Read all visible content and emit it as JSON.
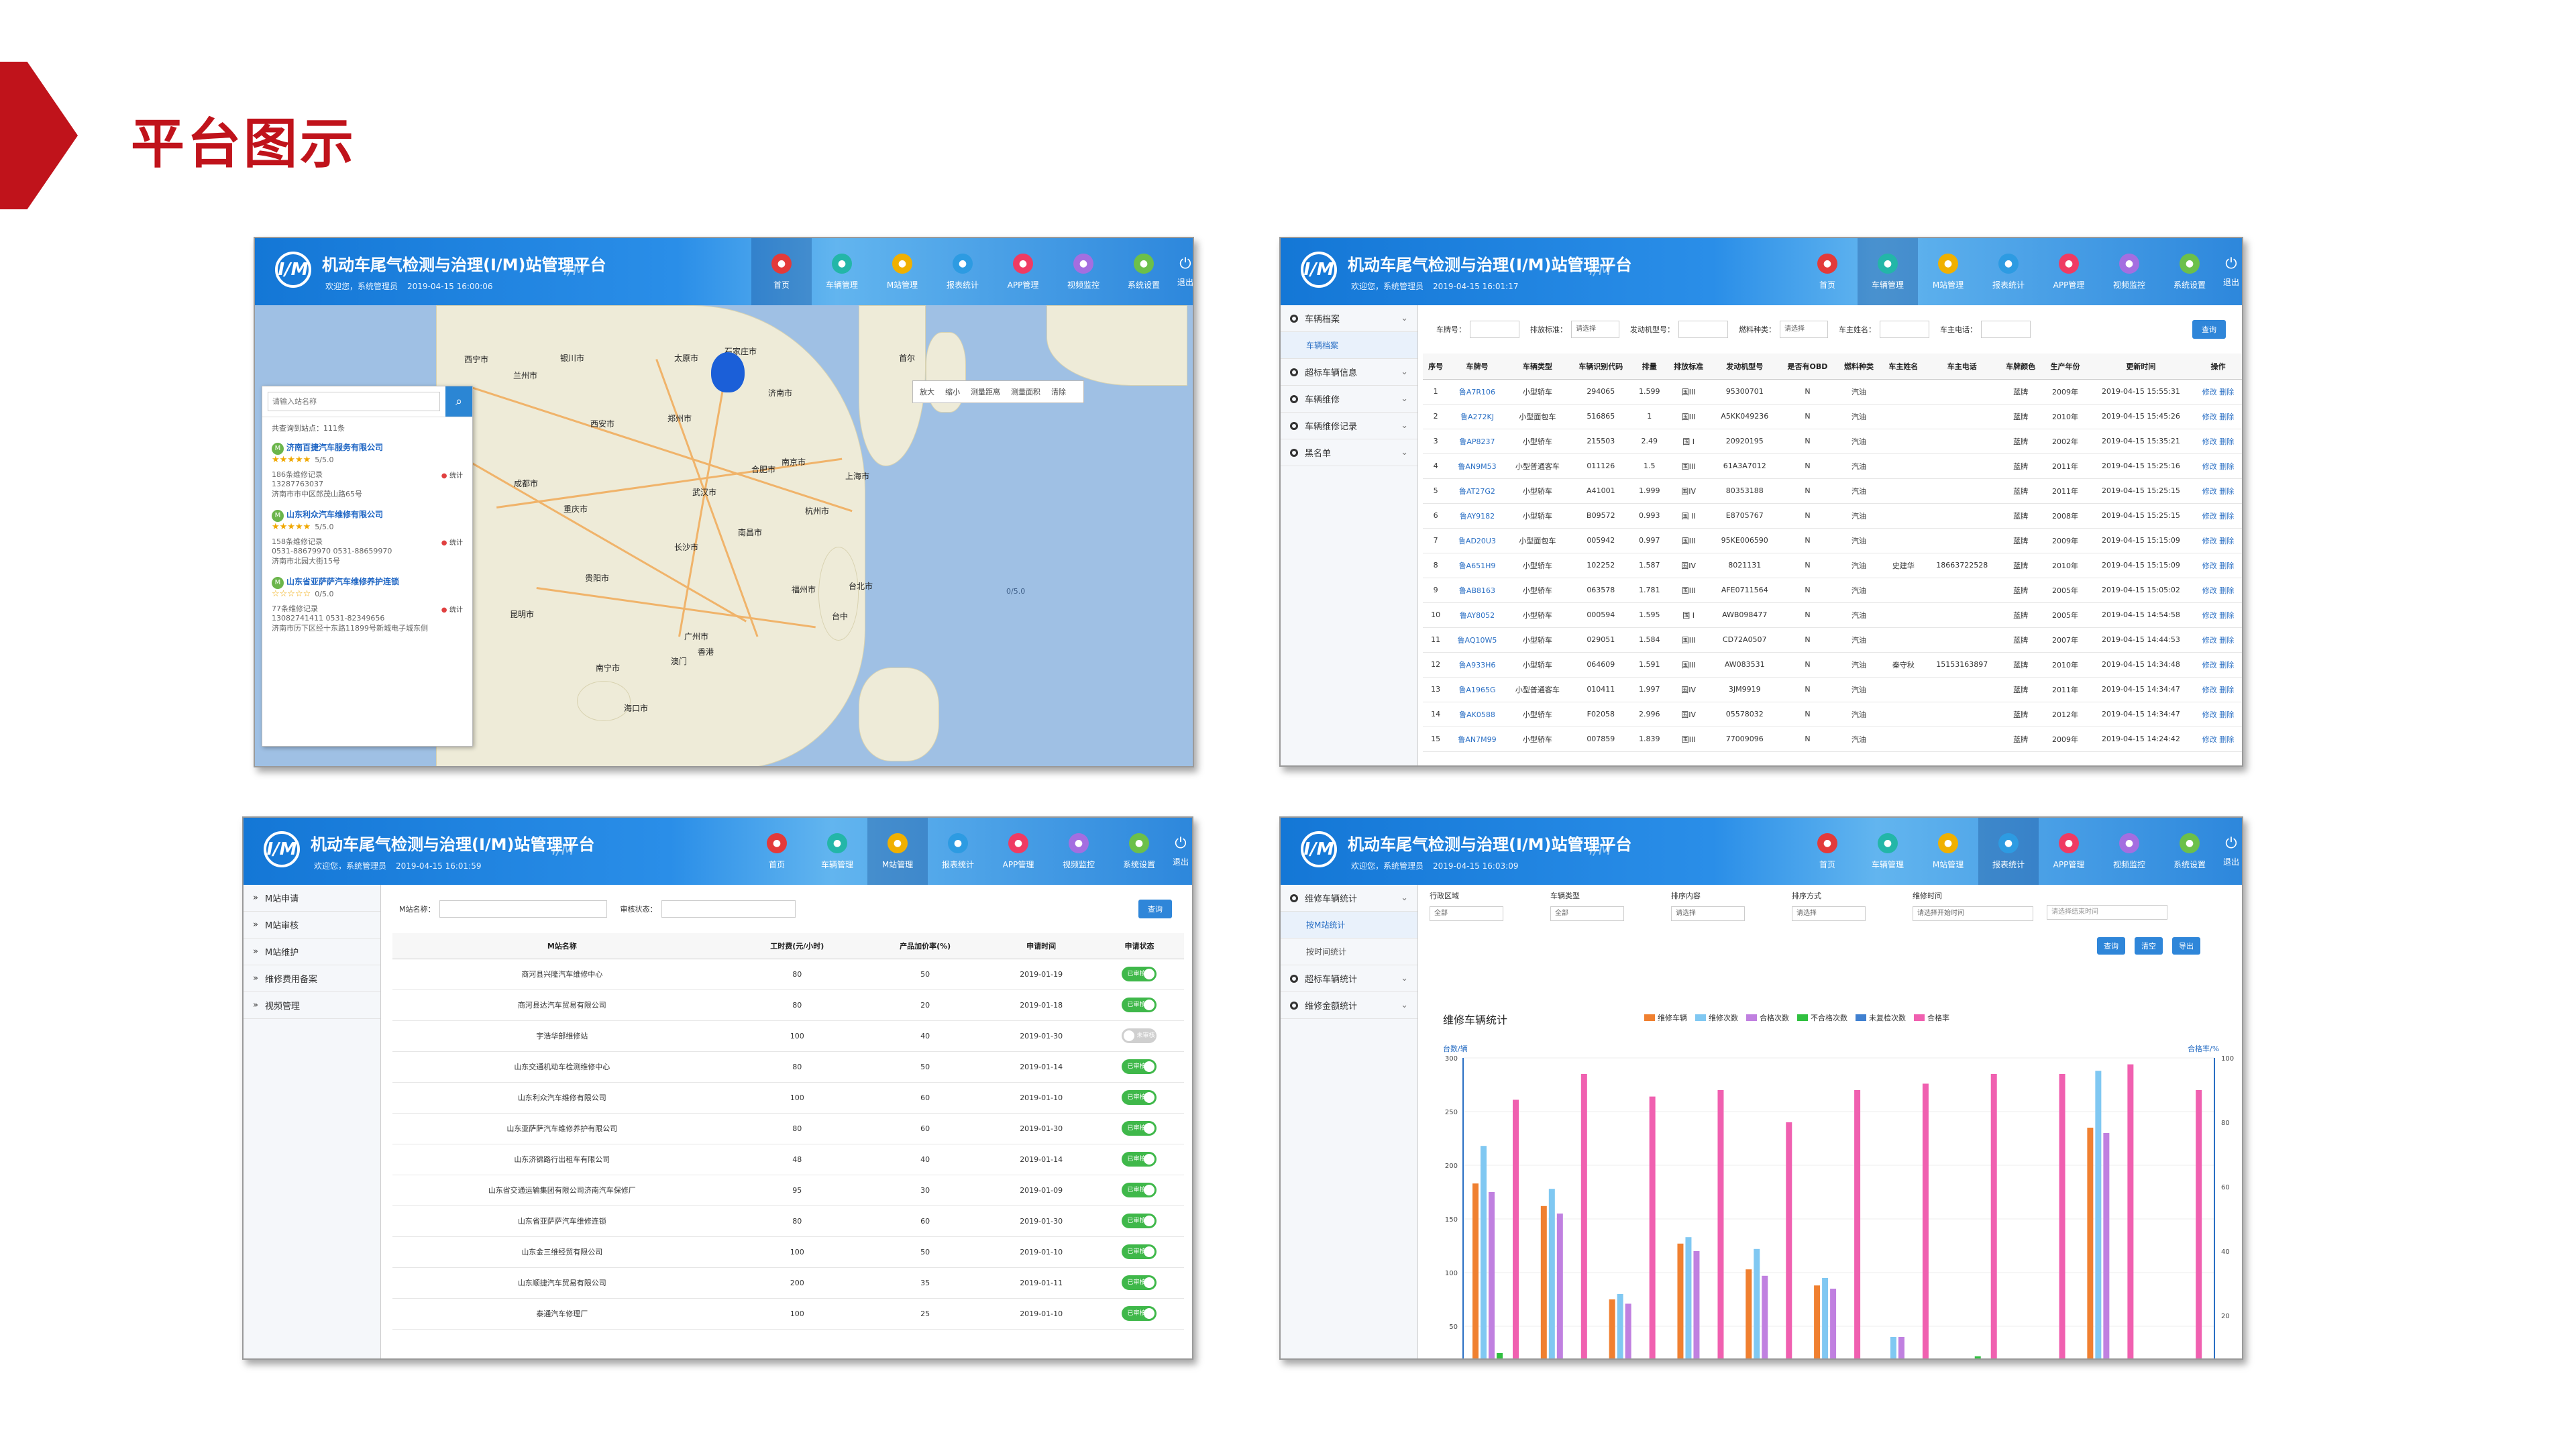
{
  "slide_title": "平台图示",
  "app": {
    "title": "机动车尾气检测与治理(I/M)站管理平台",
    "watermark": "I/M",
    "user": "欢迎您，系统管理员",
    "logo": "I/M"
  },
  "nav": [
    {
      "label": "首页",
      "icon": "home-icon",
      "color": "#e33a3a"
    },
    {
      "label": "车辆管理",
      "icon": "car-icon",
      "color": "#23b6a8"
    },
    {
      "label": "M站管理",
      "icon": "m-station-icon",
      "color": "#f0b000"
    },
    {
      "label": "报表统计",
      "icon": "report-icon",
      "color": "#2d9be2"
    },
    {
      "label": "APP管理",
      "icon": "phone-icon",
      "color": "#ef3b63"
    },
    {
      "label": "视频监控",
      "icon": "video-icon",
      "color": "#a46ee0"
    },
    {
      "label": "系统设置",
      "icon": "gear-icon",
      "color": "#6cc04a"
    }
  ],
  "exit_label": "退出",
  "panel1": {
    "date": "2019-04-15 16:00:06",
    "search_placeholder": "请输入站名称",
    "count": "共查询到站点：111条",
    "map_tools": [
      "放大",
      "缩小",
      "测量距离",
      "测量面积",
      "清除"
    ],
    "stations": [
      {
        "name": "济南百捷汽车服务有限公司",
        "score": "5/5.0",
        "stars": "★★★★★",
        "records": "186条维修记录",
        "phone": "13287763037",
        "address": "济南市市中区郎茂山路65号"
      },
      {
        "name": "山东利众汽车维修有限公司",
        "score": "5/5.0",
        "stars": "★★★★★",
        "records": "158条维修记录",
        "phone": "0531-88679970 0531-88659970",
        "address": "济南市北园大街15号"
      },
      {
        "name": "山东省亚萨萨汽车维修养护连锁",
        "score": "0/5.0",
        "stars": "☆☆☆☆☆",
        "records": "77条维修记录",
        "phone": "13082741411 0531-82349656",
        "address": "济南市历下区经十东路11899号新城电子城东侧"
      }
    ],
    "stat_label": "统计",
    "cities": [
      {
        "t": "西宁市",
        "x": 312,
        "y": 72
      },
      {
        "t": "兰州市",
        "x": 385,
        "y": 96
      },
      {
        "t": "银川市",
        "x": 455,
        "y": 70
      },
      {
        "t": "太原市",
        "x": 625,
        "y": 70
      },
      {
        "t": "石家庄市",
        "x": 700,
        "y": 60
      },
      {
        "t": "郑州市",
        "x": 615,
        "y": 160
      },
      {
        "t": "济南市",
        "x": 765,
        "y": 122
      },
      {
        "t": "西安市",
        "x": 500,
        "y": 168
      },
      {
        "t": "南京市",
        "x": 785,
        "y": 225
      },
      {
        "t": "合肥市",
        "x": 740,
        "y": 236
      },
      {
        "t": "上海市",
        "x": 880,
        "y": 246
      },
      {
        "t": "武汉市",
        "x": 652,
        "y": 270
      },
      {
        "t": "成都市",
        "x": 386,
        "y": 257
      },
      {
        "t": "重庆市",
        "x": 460,
        "y": 295
      },
      {
        "t": "杭州市",
        "x": 820,
        "y": 298
      },
      {
        "t": "长沙市",
        "x": 625,
        "y": 352
      },
      {
        "t": "南昌市",
        "x": 720,
        "y": 330
      },
      {
        "t": "贵阳市",
        "x": 492,
        "y": 398
      },
      {
        "t": "福州市",
        "x": 800,
        "y": 415
      },
      {
        "t": "台北市",
        "x": 885,
        "y": 410
      },
      {
        "t": "广州市",
        "x": 640,
        "y": 485
      },
      {
        "t": "昆明市",
        "x": 380,
        "y": 452
      },
      {
        "t": "南宁市",
        "x": 508,
        "y": 532
      },
      {
        "t": "香港",
        "x": 660,
        "y": 508
      },
      {
        "t": "澳门",
        "x": 620,
        "y": 522
      },
      {
        "t": "海口市",
        "x": 550,
        "y": 592
      },
      {
        "t": "首尔",
        "x": 960,
        "y": 70
      },
      {
        "t": "台中",
        "x": 860,
        "y": 455
      }
    ]
  },
  "panel2": {
    "date": "2019-04-15 16:01:17",
    "menu": [
      {
        "label": "车辆档案",
        "type": "group"
      },
      {
        "label": "车辆档案",
        "type": "sub"
      },
      {
        "label": "超标车辆信息",
        "type": "group"
      },
      {
        "label": "车辆维修",
        "type": "group"
      },
      {
        "label": "车辆维修记录",
        "type": "group"
      },
      {
        "label": "黑名单",
        "type": "group"
      }
    ],
    "filters": [
      "车牌号：",
      "排放标准：",
      "发动机型号：",
      "燃料种类：",
      "车主姓名：",
      "车主电话："
    ],
    "select_placeholder": "请选择",
    "query": "查询",
    "columns": [
      "序号",
      "车牌号",
      "车辆类型",
      "车辆识别代码",
      "排量",
      "排放标准",
      "发动机型号",
      "是否有OBD",
      "燃料种类",
      "车主姓名",
      "车主电话",
      "车牌颜色",
      "生产年份",
      "更新时间",
      "操作"
    ],
    "ops": "修改 删除",
    "rows": [
      [
        "1",
        "鲁A7R106",
        "小型轿车",
        "294065",
        "1.599",
        "国III",
        "95300701",
        "N",
        "汽油",
        "",
        "",
        "蓝牌",
        "2009年",
        "2019-04-15 15:55:31"
      ],
      [
        "2",
        "鲁A272KJ",
        "小型面包车",
        "516865",
        "1",
        "国III",
        "A5KK049236",
        "N",
        "汽油",
        "",
        "",
        "蓝牌",
        "2010年",
        "2019-04-15 15:45:26"
      ],
      [
        "3",
        "鲁AP8237",
        "小型轿车",
        "215503",
        "2.49",
        "国 I",
        "20920195",
        "N",
        "汽油",
        "",
        "",
        "蓝牌",
        "2002年",
        "2019-04-15 15:35:21"
      ],
      [
        "4",
        "鲁AN9M53",
        "小型普通客车",
        "011126",
        "1.5",
        "国III",
        "61A3A7012",
        "N",
        "汽油",
        "",
        "",
        "蓝牌",
        "2011年",
        "2019-04-15 15:25:16"
      ],
      [
        "5",
        "鲁AT27G2",
        "小型轿车",
        "A41001",
        "1.999",
        "国IV",
        "80353188",
        "N",
        "汽油",
        "",
        "",
        "蓝牌",
        "2011年",
        "2019-04-15 15:25:15"
      ],
      [
        "6",
        "鲁AY9182",
        "小型轿车",
        "B09572",
        "0.993",
        "国 II",
        "E8705767",
        "N",
        "汽油",
        "",
        "",
        "蓝牌",
        "2008年",
        "2019-04-15 15:25:15"
      ],
      [
        "7",
        "鲁AD20U3",
        "小型面包车",
        "005942",
        "0.997",
        "国III",
        "95KE006590",
        "N",
        "汽油",
        "",
        "",
        "蓝牌",
        "2009年",
        "2019-04-15 15:15:09"
      ],
      [
        "8",
        "鲁A651H9",
        "小型轿车",
        "102252",
        "1.587",
        "国IV",
        "8021131",
        "N",
        "汽油",
        "史建华",
        "18663722528",
        "蓝牌",
        "2010年",
        "2019-04-15 15:15:09"
      ],
      [
        "9",
        "鲁AB8163",
        "小型轿车",
        "063578",
        "1.781",
        "国III",
        "AFE0711564",
        "N",
        "汽油",
        "",
        "",
        "蓝牌",
        "2005年",
        "2019-04-15 15:05:02"
      ],
      [
        "10",
        "鲁AY8052",
        "小型轿车",
        "000594",
        "1.595",
        "国 I",
        "AWB098477",
        "N",
        "汽油",
        "",
        "",
        "蓝牌",
        "2005年",
        "2019-04-15 14:54:58"
      ],
      [
        "11",
        "鲁AQ10W5",
        "小型轿车",
        "029051",
        "1.584",
        "国III",
        "CD72A0507",
        "N",
        "汽油",
        "",
        "",
        "蓝牌",
        "2007年",
        "2019-04-15 14:44:53"
      ],
      [
        "12",
        "鲁A933H6",
        "小型轿车",
        "064609",
        "1.591",
        "国III",
        "AW083531",
        "N",
        "汽油",
        "秦守秋",
        "15153163897",
        "蓝牌",
        "2010年",
        "2019-04-15 14:34:48"
      ],
      [
        "13",
        "鲁A1965G",
        "小型普通客车",
        "010411",
        "1.997",
        "国IV",
        "3JM9919",
        "N",
        "汽油",
        "",
        "",
        "蓝牌",
        "2011年",
        "2019-04-15 14:34:47"
      ],
      [
        "14",
        "鲁AK0588",
        "小型轿车",
        "F02058",
        "2.996",
        "国IV",
        "05578032",
        "N",
        "汽油",
        "",
        "",
        "蓝牌",
        "2012年",
        "2019-04-15 14:34:47"
      ],
      [
        "15",
        "鲁AN7M99",
        "小型轿车",
        "007859",
        "1.839",
        "国III",
        "77009096",
        "N",
        "汽油",
        "",
        "",
        "蓝牌",
        "2009年",
        "2019-04-15 14:24:42"
      ]
    ]
  },
  "panel3": {
    "date": "2019-04-15 16:01:59",
    "menu": [
      "M站申请",
      "M站审核",
      "M站维护",
      "维修费用备案",
      "视频管理"
    ],
    "filters": [
      "M站名称：",
      "审核状态："
    ],
    "query": "查询",
    "columns": [
      "M站名称",
      "工时费(元/小时)",
      "产品加价率(%)",
      "申请时间",
      "申请状态"
    ],
    "toggle_on": "已审核",
    "toggle_off": "未审核",
    "rows": [
      {
        "name": "商河县兴隆汽车维修中心",
        "fee": "80",
        "rate": "50",
        "date": "2019-01-19",
        "on": true
      },
      {
        "name": "商河县达汽车贸易有限公司",
        "fee": "80",
        "rate": "20",
        "date": "2019-01-18",
        "on": true
      },
      {
        "name": "宇浩华部维修站",
        "fee": "100",
        "rate": "40",
        "date": "2019-01-30",
        "on": false
      },
      {
        "name": "山东交通机动车检测维修中心",
        "fee": "80",
        "rate": "50",
        "date": "2019-01-14",
        "on": true
      },
      {
        "name": "山东利众汽车维修有限公司",
        "fee": "100",
        "rate": "60",
        "date": "2019-01-10",
        "on": true
      },
      {
        "name": "山东亚萨萨汽车维修养护有限公司",
        "fee": "80",
        "rate": "60",
        "date": "2019-01-30",
        "on": true
      },
      {
        "name": "山东济锦路行出租车有限公司",
        "fee": "48",
        "rate": "40",
        "date": "2019-01-14",
        "on": true
      },
      {
        "name": "山东省交通运输集团有限公司济南汽车保修厂",
        "fee": "95",
        "rate": "30",
        "date": "2019-01-09",
        "on": true
      },
      {
        "name": "山东省亚萨萨汽车维修连锁",
        "fee": "80",
        "rate": "60",
        "date": "2019-01-30",
        "on": true
      },
      {
        "name": "山东金三维经贸有限公司",
        "fee": "100",
        "rate": "50",
        "date": "2019-01-10",
        "on": true
      },
      {
        "name": "山东顺捷汽车贸易有限公司",
        "fee": "200",
        "rate": "35",
        "date": "2019-01-11",
        "on": true
      },
      {
        "name": "泰通汽车修理厂",
        "fee": "100",
        "rate": "25",
        "date": "2019-01-10",
        "on": true
      }
    ]
  },
  "panel4": {
    "date": "2019-04-15 16:03:09",
    "menu": [
      {
        "label": "维修车辆统计",
        "type": "group"
      },
      {
        "label": "按M站统计",
        "type": "sub"
      },
      {
        "label": "按时间统计",
        "type": "subplain"
      },
      {
        "label": "超标车辆统计",
        "type": "group"
      },
      {
        "label": "维修金额统计",
        "type": "group"
      }
    ],
    "filters": [
      {
        "label": "行政区域",
        "value": "全部"
      },
      {
        "label": "车辆类型",
        "value": "全部"
      },
      {
        "label": "排序内容",
        "value": "请选择"
      },
      {
        "label": "排序方式",
        "value": "请选择"
      },
      {
        "label": "维修时间",
        "value": "请选择开始时间"
      }
    ],
    "end_time": "请选择结束时间",
    "buttons": [
      "查询",
      "清空",
      "导出"
    ],
    "chart_title": "维修车辆统计",
    "left_axis_label": "台数/辆",
    "right_axis_label": "合格率/%"
  },
  "chart_data": {
    "type": "bar",
    "title": "维修车辆统计",
    "ylabel": "台数/辆",
    "y2label": "合格率/%",
    "ylim": [
      0,
      300
    ],
    "y2lim": [
      0,
      100
    ],
    "yticks": [
      0,
      50,
      100,
      150,
      200,
      250,
      300
    ],
    "y2ticks": [
      0,
      20,
      40,
      60,
      80,
      100
    ],
    "legend_position": "top",
    "categories": 11,
    "series": [
      {
        "name": "维修车辆",
        "color": "#f08030",
        "values": [
          183,
          162,
          75,
          127,
          103,
          88,
          0,
          0,
          0,
          235,
          0
        ]
      },
      {
        "name": "维修次数",
        "color": "#80c8f2",
        "values": [
          218,
          178,
          80,
          133,
          122,
          95,
          40,
          0,
          0,
          288,
          0
        ]
      },
      {
        "name": "合格次数",
        "color": "#c080e0",
        "values": [
          175,
          155,
          71,
          120,
          97,
          85,
          40,
          0,
          0,
          230,
          0
        ]
      },
      {
        "name": "不合格次数",
        "color": "#30c040",
        "values": [
          25,
          10,
          12,
          20,
          10,
          5,
          0,
          22,
          0,
          5,
          0
        ]
      },
      {
        "name": "未复检次数",
        "color": "#4080d0",
        "values": [
          12,
          6,
          5,
          10,
          5,
          3,
          4,
          0,
          0,
          4,
          0
        ]
      },
      {
        "name": "合格率",
        "color": "#f060b0",
        "values": [
          87,
          95,
          88,
          90,
          80,
          90,
          92,
          95,
          95,
          98,
          90
        ]
      }
    ]
  }
}
